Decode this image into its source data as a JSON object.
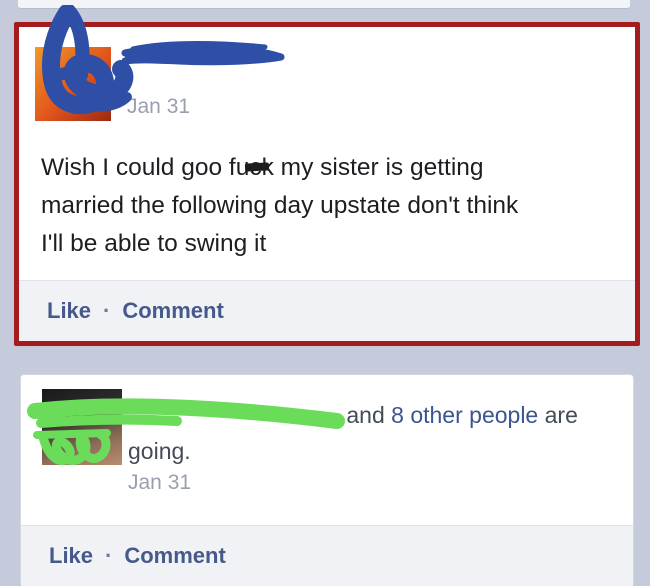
{
  "posts": [
    {
      "date": "Jan 31",
      "text_lines": [
        "Wish I could goo f",
        "k my sister is getting",
        "married the following day upstate don't think",
        "I'll be able to swing it"
      ],
      "censor_letters": "uc",
      "actions": {
        "like": "Like",
        "separator": "·",
        "comment": "Comment"
      }
    },
    {
      "date": "Jan 31",
      "going": {
        "connector": "and",
        "others_link": "8 other people",
        "verb": "are",
        "line2": "going."
      },
      "actions": {
        "like": "Like",
        "separator": "·",
        "comment": "Comment"
      }
    }
  ],
  "colors": {
    "highlight_border": "#a51c1f",
    "link_blue": "#46598b",
    "blue_scribble": "#2f4fa7",
    "green_scribble": "#6bdc5a"
  }
}
